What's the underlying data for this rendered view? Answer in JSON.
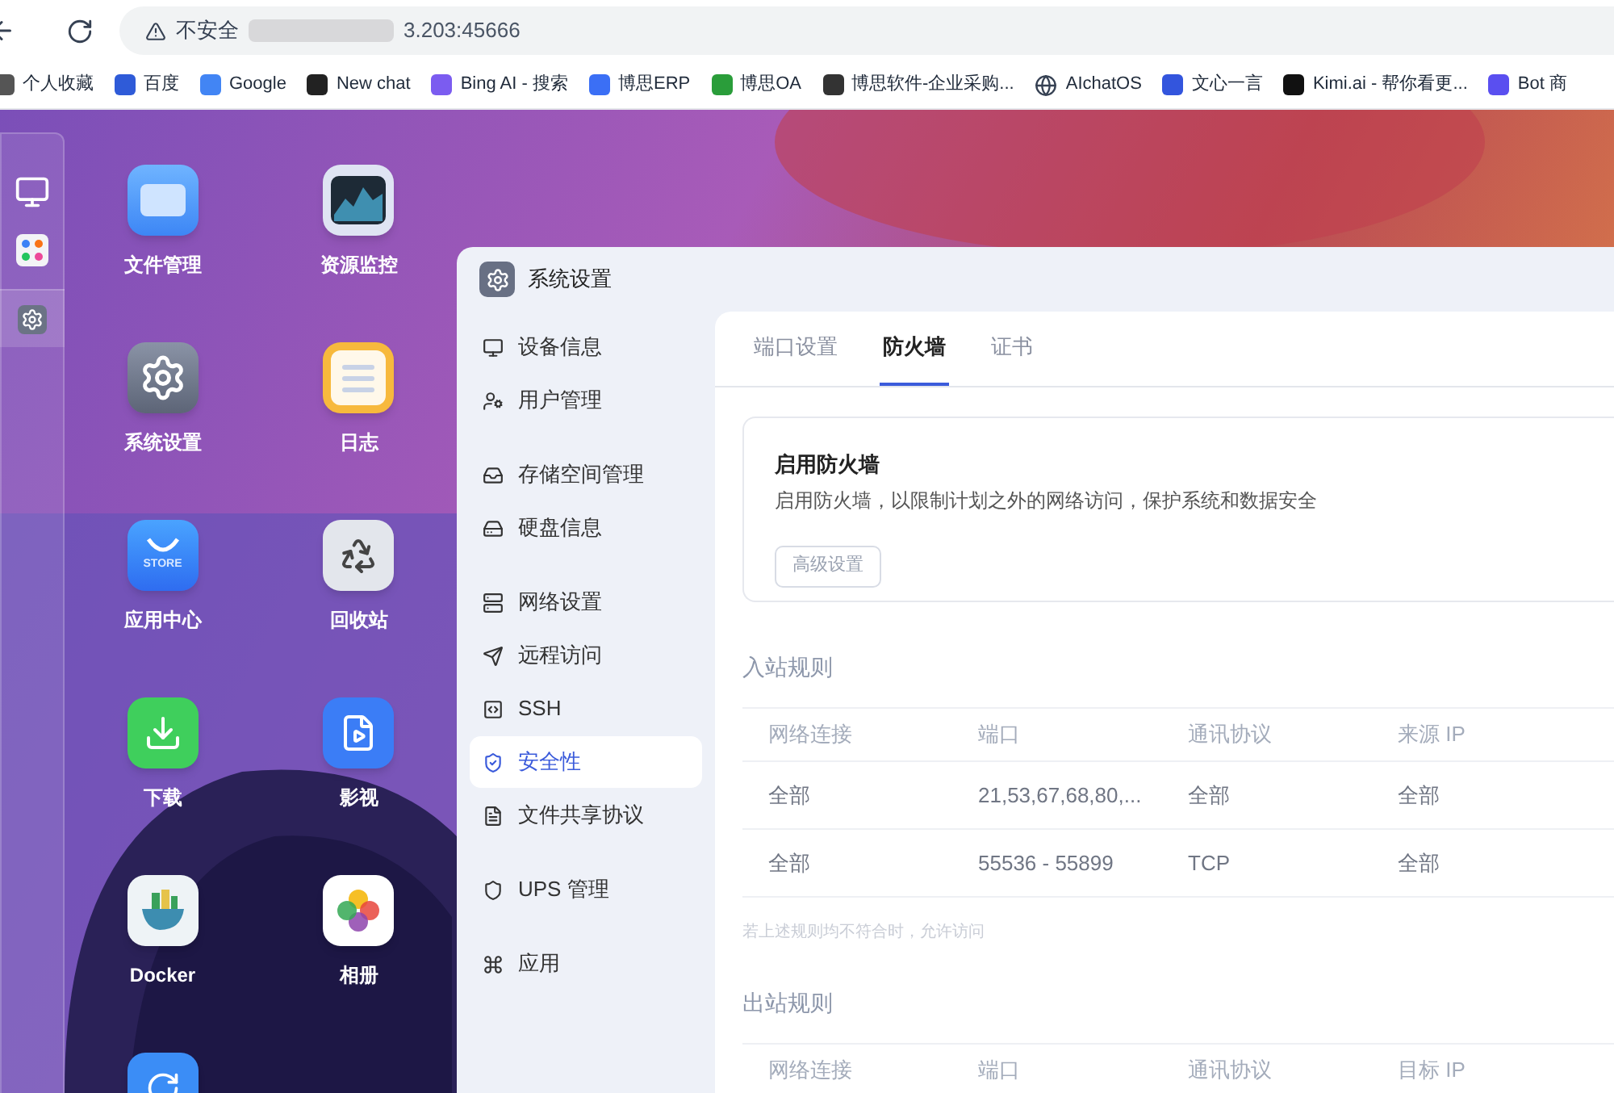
{
  "browser": {
    "security": "不安全",
    "address": "3.203:45666"
  },
  "bookmarks": [
    "个人收藏",
    "百度",
    "Google",
    "New chat",
    "Bing AI - 搜索",
    "博思ERP",
    "博思OA",
    "博思软件-企业采购...",
    "AIchatOS",
    "文心一言",
    "Kimi.ai - 帮你看更...",
    "Bot 商"
  ],
  "dock": [
    {
      "selected": false
    },
    {
      "selected": false
    },
    {
      "selected": true
    }
  ],
  "apps": [
    {
      "kind": "app",
      "label": "文件管理"
    },
    {
      "kind": "app",
      "label": "资源监控"
    },
    {
      "kind": "app",
      "label": "系统设置"
    },
    {
      "kind": "app",
      "label": "日志"
    },
    {
      "kind": "app",
      "label": "应用中心",
      "badge_text": "STORE"
    },
    {
      "kind": "app",
      "label": "回收站"
    },
    {
      "kind": "app",
      "label": "下载"
    },
    {
      "kind": "app",
      "label": "影视"
    },
    {
      "kind": "app",
      "label": "Docker"
    },
    {
      "kind": "app",
      "label": "相册"
    },
    {
      "kind": "cut_off"
    }
  ],
  "window": {
    "title": "系统设置"
  },
  "sidebar": {
    "groups": [
      [
        {
          "label": "设备信息",
          "selected": false
        },
        {
          "label": "用户管理",
          "selected": false
        }
      ],
      [
        {
          "label": "存储空间管理",
          "selected": false
        },
        {
          "label": "硬盘信息",
          "selected": false
        }
      ],
      [
        {
          "label": "网络设置",
          "selected": false
        },
        {
          "label": "远程访问",
          "selected": false
        },
        {
          "label": "SSH",
          "selected": false
        },
        {
          "label": "安全性",
          "selected": true
        },
        {
          "label": "文件共享协议",
          "selected": false
        }
      ],
      [
        {
          "label": "UPS 管理",
          "selected": false
        }
      ],
      [
        {
          "label": "应用",
          "selected": false
        }
      ]
    ]
  },
  "tabs": [
    {
      "label": "端口设置",
      "selected": false
    },
    {
      "label": "防火墙",
      "selected": true
    },
    {
      "label": "证书",
      "selected": false
    }
  ],
  "firewall": {
    "title": "启用防火墙",
    "description": "启用防火墙，以限制计划之外的网络访问，保护系统和数据安全",
    "button": "高级设置"
  },
  "inbound": {
    "title": "入站规则",
    "columns": [
      "网络连接",
      "端口",
      "通讯协议",
      "来源 IP"
    ],
    "rows": [
      [
        "全部",
        "21,53,67,68,80,...",
        "全部",
        "全部"
      ],
      [
        "全部",
        "55536 - 55899",
        "TCP",
        "全部"
      ]
    ],
    "note": "若上述规则均不符合时，允许访问"
  },
  "outbound": {
    "title": "出站规则",
    "columns": [
      "网络连接",
      "端口",
      "通讯协议",
      "目标 IP"
    ]
  }
}
